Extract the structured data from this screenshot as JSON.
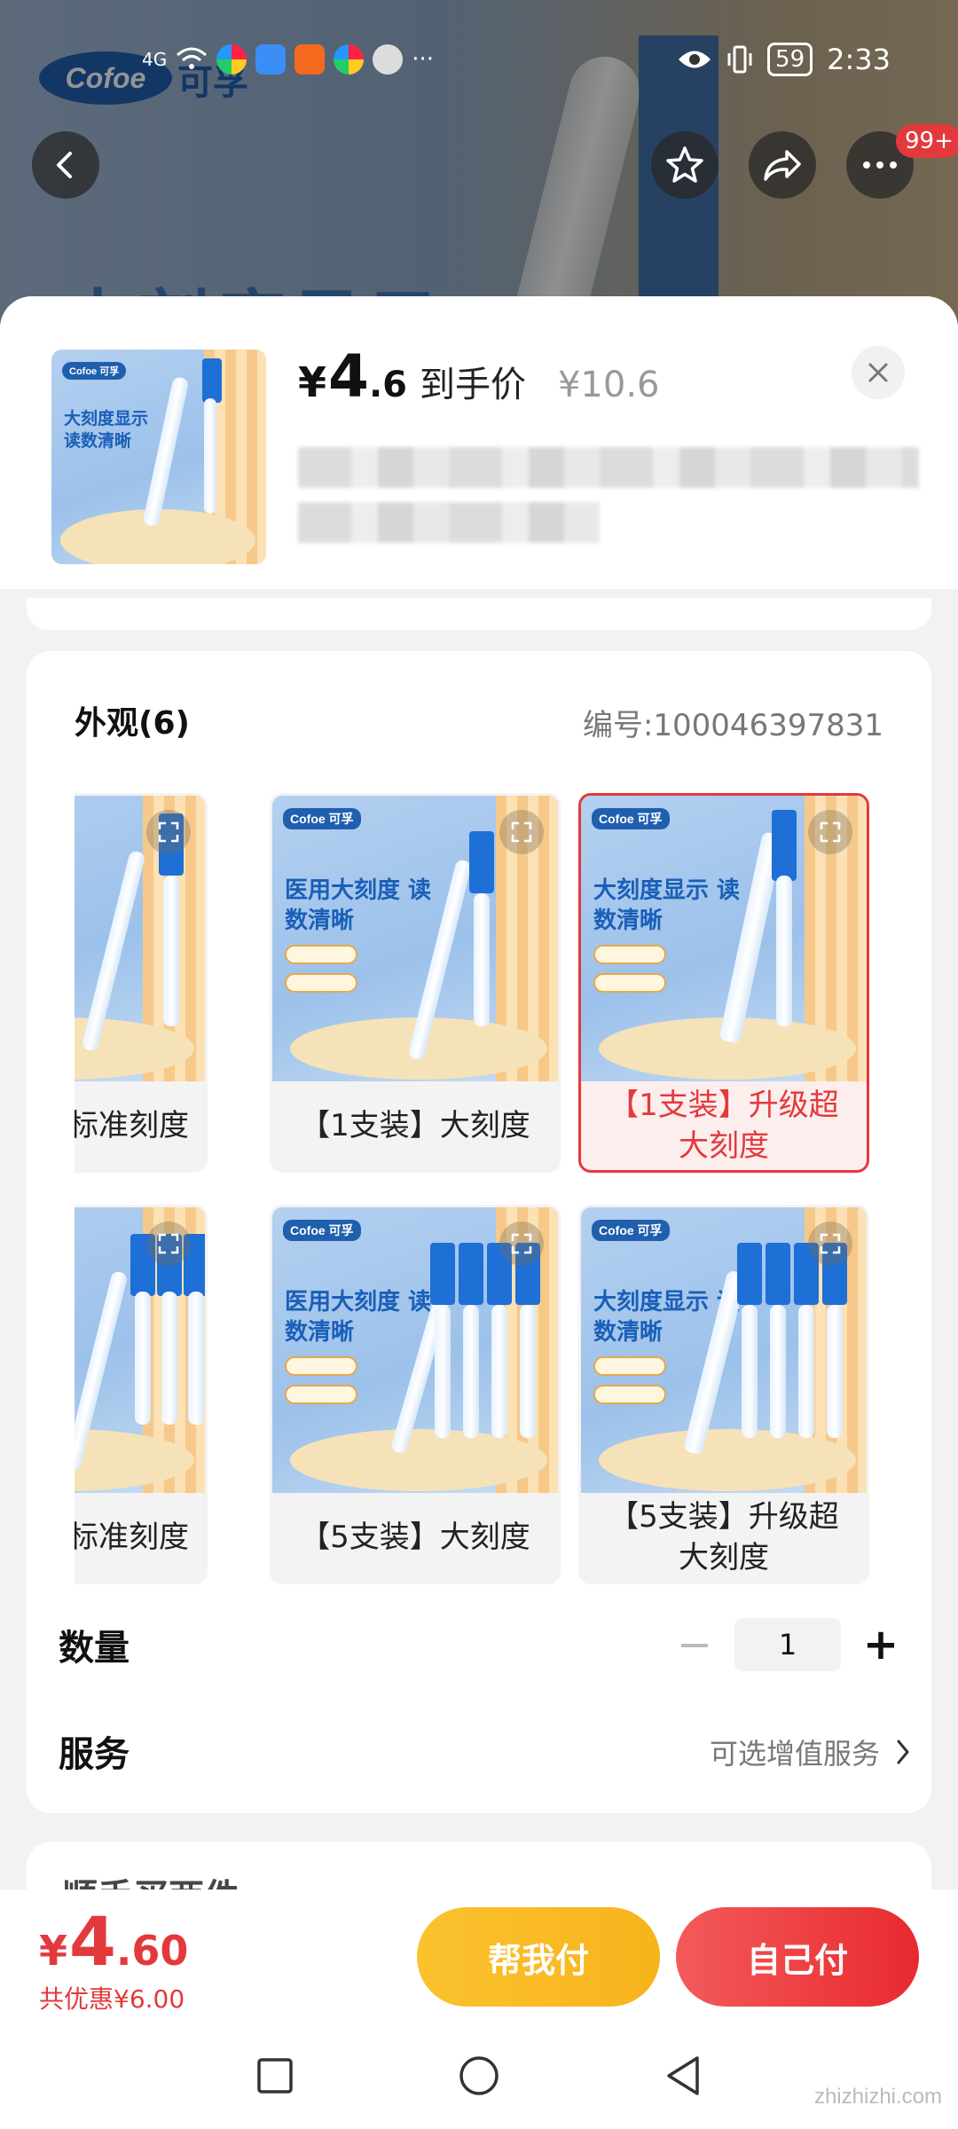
{
  "status_bar": {
    "signal": "4G",
    "time": "2:33",
    "battery": "59"
  },
  "background": {
    "logo": "Cofoe",
    "logo_cn": "可孚",
    "big_text": "大刻度显示"
  },
  "header": {
    "thumb_logo": "Cofoe 可孚",
    "thumb_promo": "大刻度显示 读数清晰",
    "price_symbol": "¥",
    "price_integer": "4",
    "price_decimal": ".6",
    "price_tag": "到手价",
    "original_price": "¥10.6",
    "close_label": "×"
  },
  "appearance": {
    "title": "外观(6)",
    "sku": "编号:100046397831",
    "options": [
      {
        "label": "装】标准刻度",
        "promo": "",
        "selected": false
      },
      {
        "label": "【1支装】大刻度",
        "promo": "医用大刻度 读数清晰",
        "selected": false
      },
      {
        "label": "【1支装】升级超大刻度",
        "promo": "大刻度显示 读数清晰",
        "selected": true
      },
      {
        "label": "装】标准刻度",
        "promo": "",
        "selected": false
      },
      {
        "label": "【5支装】大刻度",
        "promo": "医用大刻度 读数清晰",
        "selected": false
      },
      {
        "label": "【5支装】升级超大刻度",
        "promo": "大刻度显示 读数清晰",
        "selected": false
      }
    ]
  },
  "quantity": {
    "label": "数量",
    "value": "1",
    "minus": "−",
    "plus": "+"
  },
  "service": {
    "label": "服务",
    "value": "可选增值服务"
  },
  "peek": {
    "text": "顺手买两件"
  },
  "footer": {
    "price_symbol": "¥",
    "price_integer": "4",
    "price_decimal": ".60",
    "savings": "共优惠¥6.00",
    "help_pay": "帮我付",
    "self_pay": "自己付"
  },
  "top_buttons": {
    "cart_badge": "99+"
  },
  "watermark": "zhizhizhi.com",
  "colors": {
    "accent_red": "#e4393c",
    "button_yellow": "#fbc22e",
    "brand_blue": "#1f5fae"
  }
}
